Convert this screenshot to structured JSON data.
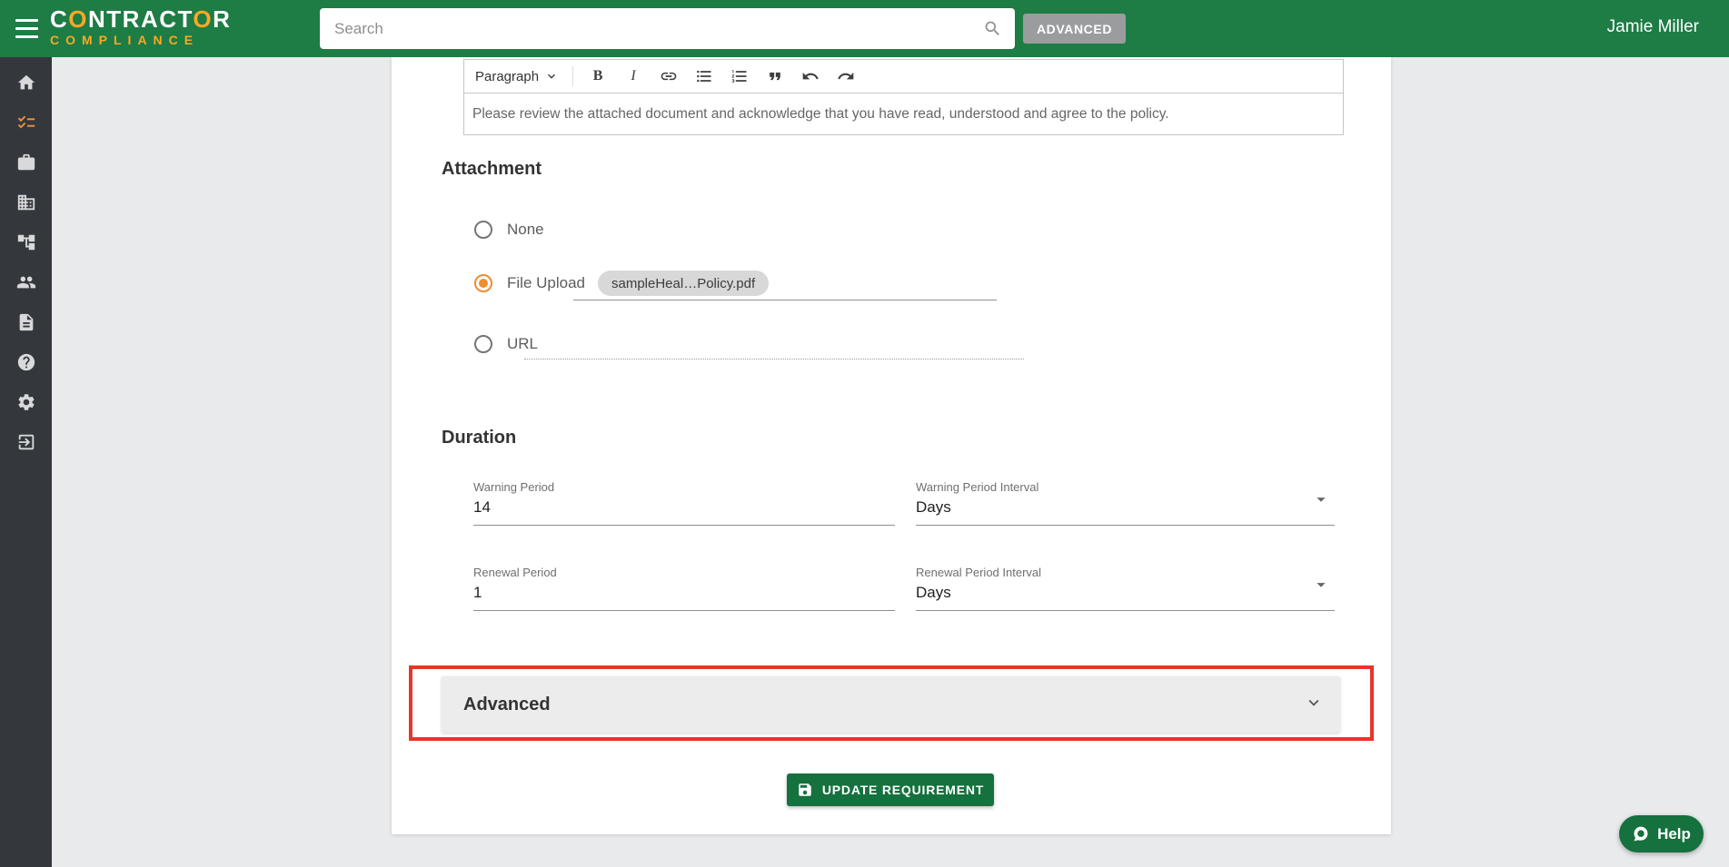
{
  "header": {
    "logo_line1": "CONTRACTOR",
    "logo_line2": "COMPLIANCE",
    "logo_accent_char": "O",
    "search_placeholder": "Search",
    "advanced_button": "ADVANCED",
    "user_name": "Jamie Miller"
  },
  "sidebar": {
    "items": [
      {
        "id": "home",
        "icon": "home-icon",
        "active": false
      },
      {
        "id": "requirements",
        "icon": "checklist-icon",
        "active": true
      },
      {
        "id": "jobs",
        "icon": "briefcase-icon",
        "active": false
      },
      {
        "id": "companies",
        "icon": "building-icon",
        "active": false
      },
      {
        "id": "org-chart",
        "icon": "tree-icon",
        "active": false
      },
      {
        "id": "contractors",
        "icon": "people-icon",
        "active": false
      },
      {
        "id": "documents",
        "icon": "document-icon",
        "active": false
      },
      {
        "id": "help",
        "icon": "help-circle-icon",
        "active": false
      },
      {
        "id": "settings",
        "icon": "gear-icon",
        "active": false
      },
      {
        "id": "logout",
        "icon": "logout-icon",
        "active": false
      }
    ]
  },
  "editor": {
    "block_format": "Paragraph",
    "bold_label": "B",
    "italic_label": "I",
    "content": "Please review the attached document and acknowledge that you have read, understood and agree to the policy."
  },
  "form": {
    "attachment": {
      "heading": "Attachment",
      "options": [
        {
          "label": "None",
          "selected": false
        },
        {
          "label": "File Upload",
          "selected": true
        },
        {
          "label": "URL",
          "selected": false
        }
      ],
      "file_chip": "sampleHeal…Policy.pdf"
    },
    "duration": {
      "heading": "Duration",
      "fields": [
        {
          "label": "Warning Period",
          "value": "14",
          "type": "text"
        },
        {
          "label": "Warning Period Interval",
          "value": "Days",
          "type": "select"
        },
        {
          "label": "Renewal Period",
          "value": "1",
          "type": "text"
        },
        {
          "label": "Renewal Period Interval",
          "value": "Days",
          "type": "select"
        }
      ]
    },
    "advanced_section_label": "Advanced",
    "submit_button": "UPDATE REQUIREMENT"
  },
  "help_widget": {
    "label": "Help"
  },
  "colors": {
    "brand_green": "#1e7c45",
    "button_green": "#15713d",
    "accent_orange": "#f0953c",
    "logo_orange": "#f9a825",
    "annotation_red": "#e8352b"
  }
}
